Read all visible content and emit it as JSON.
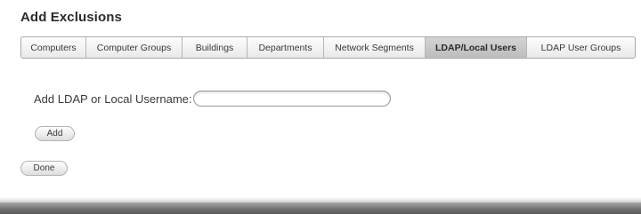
{
  "page": {
    "title": "Add Exclusions"
  },
  "tabs": [
    {
      "label": "Computers",
      "active": false
    },
    {
      "label": "Computer Groups",
      "active": false
    },
    {
      "label": "Buildings",
      "active": false
    },
    {
      "label": "Departments",
      "active": false
    },
    {
      "label": "Network Segments",
      "active": false
    },
    {
      "label": "LDAP/Local Users",
      "active": true
    },
    {
      "label": "LDAP User Groups",
      "active": false
    }
  ],
  "form": {
    "username_label": "Add LDAP or Local Username:",
    "username_value": "",
    "username_placeholder": "",
    "add_button": "Add"
  },
  "footer": {
    "done_button": "Done"
  }
}
